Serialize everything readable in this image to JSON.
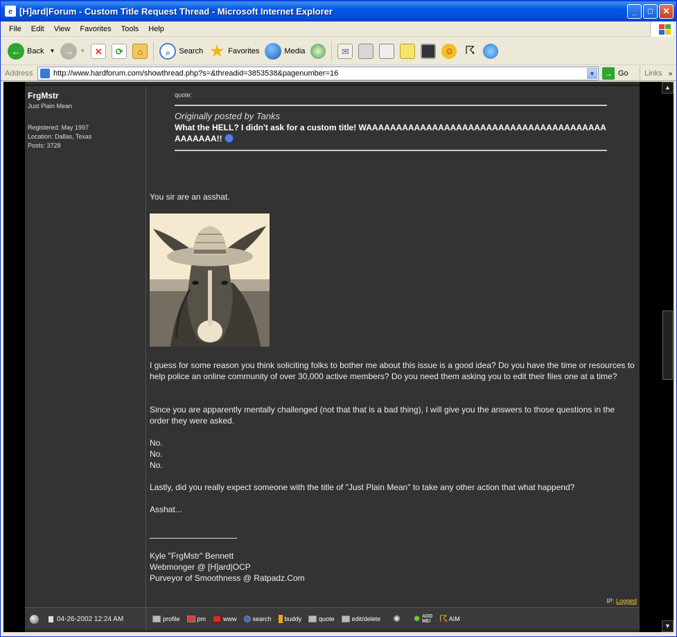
{
  "window": {
    "title": "[H]ard|Forum - Custom Title Request Thread - Microsoft Internet Explorer",
    "app_icon_glyph": "e",
    "minimize_glyph": "_",
    "maximize_glyph": "□",
    "close_glyph": "✕"
  },
  "menu": [
    "File",
    "Edit",
    "View",
    "Favorites",
    "Tools",
    "Help"
  ],
  "toolbar": {
    "back": "Back",
    "search": "Search",
    "favorites": "Favorites",
    "media": "Media"
  },
  "address": {
    "label": "Address",
    "url": "http://www.hardforum.com/showthread.php?s=&threadid=3853538&pagenumber=16",
    "go": "Go",
    "links": "Links"
  },
  "post": {
    "author": {
      "name": "FrgMstr",
      "title": "Just Plain Mean",
      "registered": "Registered: May 1997",
      "location": "Location: Dallas, Texas",
      "posts": "Posts: 3728"
    },
    "quote": {
      "label": "quote:",
      "by": "Originally posted by Tanks",
      "text": "What the HELL? I didn't ask for a custom title! WAAAAAAAAAAAAAAAAAAAAAAAAAAAAAAAAAAAAAAAAAAAAAAA!!"
    },
    "paragraphs": {
      "p1": "You sir are an asshat.",
      "p2": "I guess for some reason you think soliciting folks to bother me about this issue is a good idea? Do you have the time or resources to help police an online community of over 30,000 active members? Do you need them asking you to edit their files one at a time?",
      "p3": "Since you are apparently mentally challenged (not that that is a bad thing), I will give you the answers to those questions in the order they were asked.",
      "no1": "No.",
      "no2": "No.",
      "no3": "No.",
      "p4": "Lastly, did you really expect someone with the title of \"Just Plain Mean\" to take any other action that what happend?",
      "p5": "Asshat..."
    },
    "signature": {
      "line1": "Kyle \"FrgMstr\" Bennett",
      "line2": "Webmonger @ [H]ard|OCP",
      "line3": "Purveyor of Smoothness @ Ratpadz.Com"
    },
    "ip": {
      "label": "IP:",
      "link": "Logged"
    },
    "date": "04-26-2002 12:24 AM",
    "actions": {
      "profile": "profile",
      "pm": "pm",
      "www": "www",
      "search": "search",
      "buddy": "buddy",
      "quote": "quote",
      "edit": "edit/delete",
      "aim": "AIM"
    }
  },
  "colors": {
    "titlebar": "#0058e6",
    "forum_bg": "#333333",
    "text": "#eeeeee",
    "link": "#f0c040"
  }
}
